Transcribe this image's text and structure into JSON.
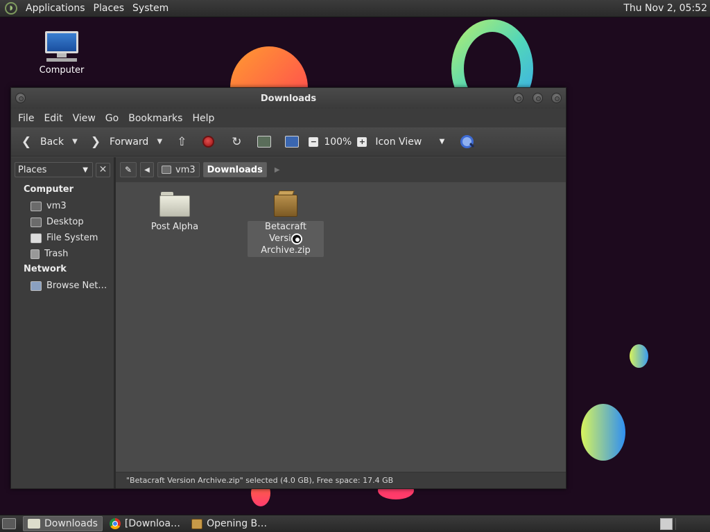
{
  "top_panel": {
    "menus": [
      "Applications",
      "Places",
      "System"
    ],
    "clock": "Thu Nov  2, 05:52"
  },
  "desktop": {
    "icons": [
      {
        "label": "Computer",
        "icon": "computer-icon"
      }
    ]
  },
  "window": {
    "title": "Downloads",
    "menubar": [
      "File",
      "Edit",
      "View",
      "Go",
      "Bookmarks",
      "Help"
    ],
    "toolbar": {
      "back_label": "Back",
      "forward_label": "Forward",
      "zoom_level": "100%",
      "view_mode": "Icon View"
    },
    "sidebar": {
      "selector": "Places",
      "groups": [
        {
          "label": "Computer",
          "items": [
            {
              "label": "vm3",
              "icon": "home-folder-icon"
            },
            {
              "label": "Desktop",
              "icon": "desktop-folder-icon"
            },
            {
              "label": "File System",
              "icon": "drive-icon"
            },
            {
              "label": "Trash",
              "icon": "trash-icon"
            }
          ]
        },
        {
          "label": "Network",
          "items": [
            {
              "label": "Browse Net…",
              "icon": "network-icon"
            }
          ]
        }
      ]
    },
    "pathbar": {
      "crumbs": [
        "vm3",
        "Downloads"
      ]
    },
    "files": [
      {
        "name": "Post Alpha",
        "type": "folder",
        "selected": false
      },
      {
        "name": "Betacraft Version Archive.zip",
        "name_line1": "Betacraft Version",
        "name_line2": "Archive.zip",
        "type": "zip",
        "selected": true
      }
    ],
    "status": "\"Betacraft Version Archive.zip\" selected (4.0 GB), Free space: 17.4 GB"
  },
  "bottom_panel": {
    "tasks": [
      {
        "label": "Downloads",
        "icon": "folder-icon",
        "active": true
      },
      {
        "label": "[Downloa…",
        "icon": "chrome-icon",
        "active": false
      },
      {
        "label": "Opening B…",
        "icon": "archive-icon",
        "active": false
      }
    ]
  },
  "colors": {
    "desktop_bg": "#1d0a1e",
    "panel_bg": "#2f2f2f",
    "window_bg": "#464646"
  }
}
